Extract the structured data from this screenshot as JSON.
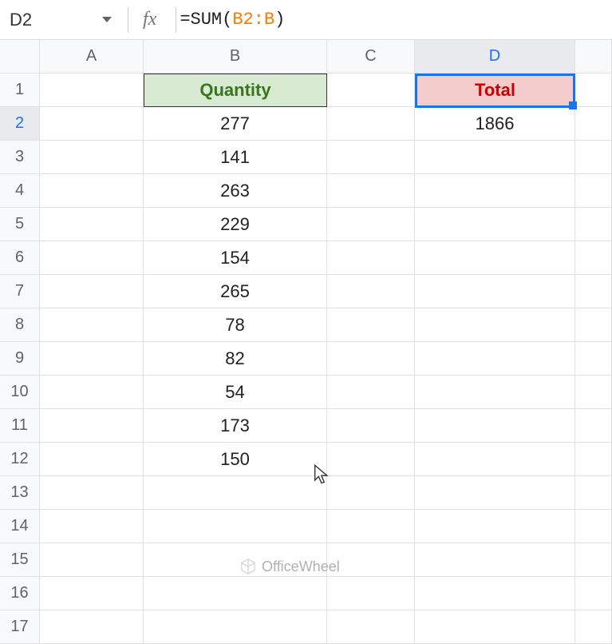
{
  "formula_bar": {
    "cell_ref": "D2",
    "fx_label": "fx",
    "formula_prefix": "=SUM",
    "formula_open": "(",
    "formula_range": "B2:B",
    "formula_close": ")"
  },
  "columns": [
    "A",
    "B",
    "C",
    "D"
  ],
  "row_count": 17,
  "headers": {
    "B": "Quantity",
    "D": "Total"
  },
  "data": {
    "B": [
      "277",
      "141",
      "263",
      "229",
      "154",
      "265",
      "78",
      "82",
      "54",
      "173",
      "150"
    ],
    "D": [
      "1866"
    ]
  },
  "selected": {
    "row": 2,
    "col": "D"
  },
  "watermark": "OfficeWheel"
}
